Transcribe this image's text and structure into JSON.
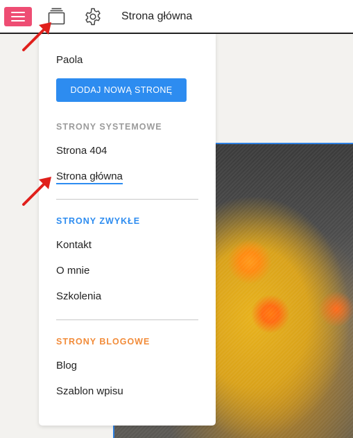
{
  "toolbar": {
    "menu_icon": "hamburger-menu-icon",
    "pages_icon": "pages-stack-icon",
    "settings_icon": "gear-icon",
    "title": "Strona główna",
    "menu_color": "#ee4d73"
  },
  "dropdown": {
    "site_name": "Paola",
    "add_button": "DODAJ NOWĄ STRONĘ",
    "system_section": {
      "heading": "STRONY SYSTEMOWE",
      "items": [
        "Strona 404",
        "Strona główna"
      ],
      "active_item": "Strona główna"
    },
    "regular_section": {
      "heading": "STRONY ZWYKŁE",
      "items": [
        "Kontakt",
        "O mnie",
        "Szkolenia"
      ]
    },
    "blog_section": {
      "heading": "STRONY BLOGOWE",
      "items": [
        "Blog",
        "Szablon wpisu"
      ]
    }
  },
  "colors": {
    "accent_blue": "#2d8cf0",
    "blog_orange": "#f28c3a",
    "system_gray": "#9b9b9b",
    "annotation_arrow": "#e0201c"
  }
}
